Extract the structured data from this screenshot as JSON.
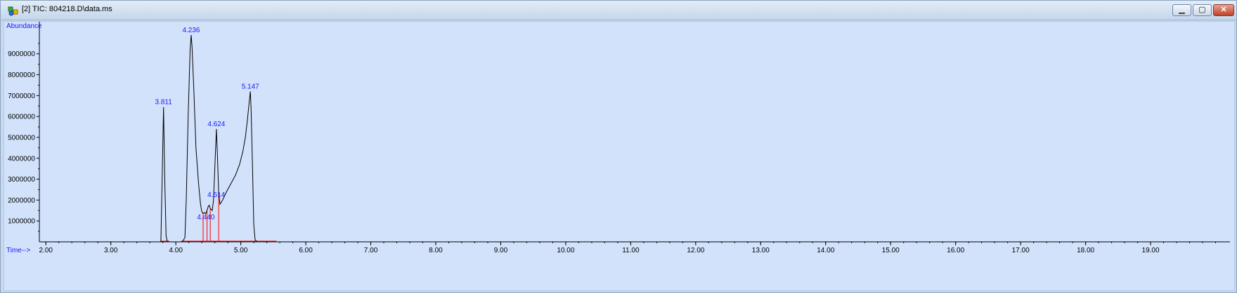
{
  "window": {
    "title": "[2] TIC: 804218.D\\data.ms",
    "icon": "chromatogram-icon",
    "controls": {
      "minimize": "▁",
      "maximize": "▢",
      "close": "✕"
    }
  },
  "colors": {
    "plot_bg": "#d2e2fb",
    "trace": "#000000",
    "integration": "#ff0000",
    "label": "#1a1aff"
  },
  "chart_data": {
    "type": "line",
    "title": "",
    "ylabel": "Abundance",
    "xlabel": "Time-->",
    "xlim": [
      1.9,
      20.2
    ],
    "ylim": [
      0,
      10400000
    ],
    "x_ticks": [
      "2.00",
      "3.00",
      "4.00",
      "5.00",
      "6.00",
      "7.00",
      "8.00",
      "9.00",
      "10.00",
      "11.00",
      "12.00",
      "13.00",
      "14.00",
      "15.00",
      "16.00",
      "17.00",
      "18.00",
      "19.00"
    ],
    "y_ticks": [
      "1000000",
      "2000000",
      "3000000",
      "4000000",
      "5000000",
      "6000000",
      "7000000",
      "8000000",
      "9000000"
    ],
    "series": [
      {
        "points": [
          [
            1.9,
            0
          ],
          [
            3.77,
            0
          ],
          [
            3.79,
            3000000
          ],
          [
            3.811,
            6450000
          ],
          [
            3.83,
            3000000
          ],
          [
            3.85,
            300000
          ],
          [
            3.87,
            0
          ],
          [
            4.1,
            0
          ],
          [
            4.14,
            200000
          ],
          [
            4.16,
            2000000
          ],
          [
            4.19,
            6000000
          ],
          [
            4.22,
            9200000
          ],
          [
            4.236,
            9900000
          ],
          [
            4.25,
            9300000
          ],
          [
            4.28,
            7000000
          ],
          [
            4.31,
            4500000
          ],
          [
            4.35,
            2800000
          ],
          [
            4.38,
            1800000
          ],
          [
            4.4,
            1450000
          ],
          [
            4.42,
            1350000
          ],
          [
            4.44,
            1400000
          ],
          [
            4.46,
            1350000
          ],
          [
            4.48,
            1500000
          ],
          [
            4.5,
            1700000
          ],
          [
            4.514,
            1750000
          ],
          [
            4.53,
            1600000
          ],
          [
            4.56,
            1500000
          ],
          [
            4.58,
            2000000
          ],
          [
            4.6,
            3500000
          ],
          [
            4.624,
            5400000
          ],
          [
            4.64,
            4200000
          ],
          [
            4.66,
            2300000
          ],
          [
            4.68,
            1800000
          ],
          [
            4.72,
            2000000
          ],
          [
            4.78,
            2400000
          ],
          [
            4.85,
            2800000
          ],
          [
            4.92,
            3200000
          ],
          [
            4.98,
            3700000
          ],
          [
            5.03,
            4300000
          ],
          [
            5.07,
            5000000
          ],
          [
            5.1,
            5800000
          ],
          [
            5.13,
            6700000
          ],
          [
            5.147,
            7200000
          ],
          [
            5.16,
            6200000
          ],
          [
            5.18,
            3500000
          ],
          [
            5.2,
            800000
          ],
          [
            5.22,
            100000
          ],
          [
            5.25,
            0
          ],
          [
            20.2,
            0
          ]
        ]
      }
    ],
    "peaks": [
      {
        "rt": 3.811,
        "label": "3.811",
        "abundance": 6450000
      },
      {
        "rt": 4.236,
        "label": "4.236",
        "abundance": 9900000
      },
      {
        "rt": 4.44,
        "label": "4.440",
        "abundance": 1400000
      },
      {
        "rt": 4.514,
        "label": "4.514",
        "abundance": 1750000
      },
      {
        "rt": 4.624,
        "label": "4.624",
        "abundance": 5400000
      },
      {
        "rt": 5.147,
        "label": "5.147",
        "abundance": 7200000
      }
    ],
    "integration_marks": [
      {
        "rt": 4.42,
        "abundance": 1350000
      },
      {
        "rt": 4.48,
        "abundance": 1500000
      },
      {
        "rt": 4.53,
        "abundance": 1600000
      },
      {
        "rt": 4.66,
        "abundance": 2300000
      }
    ],
    "baseline_segments": [
      {
        "from": 3.76,
        "to": 3.9
      },
      {
        "from": 4.08,
        "to": 5.55
      }
    ]
  }
}
